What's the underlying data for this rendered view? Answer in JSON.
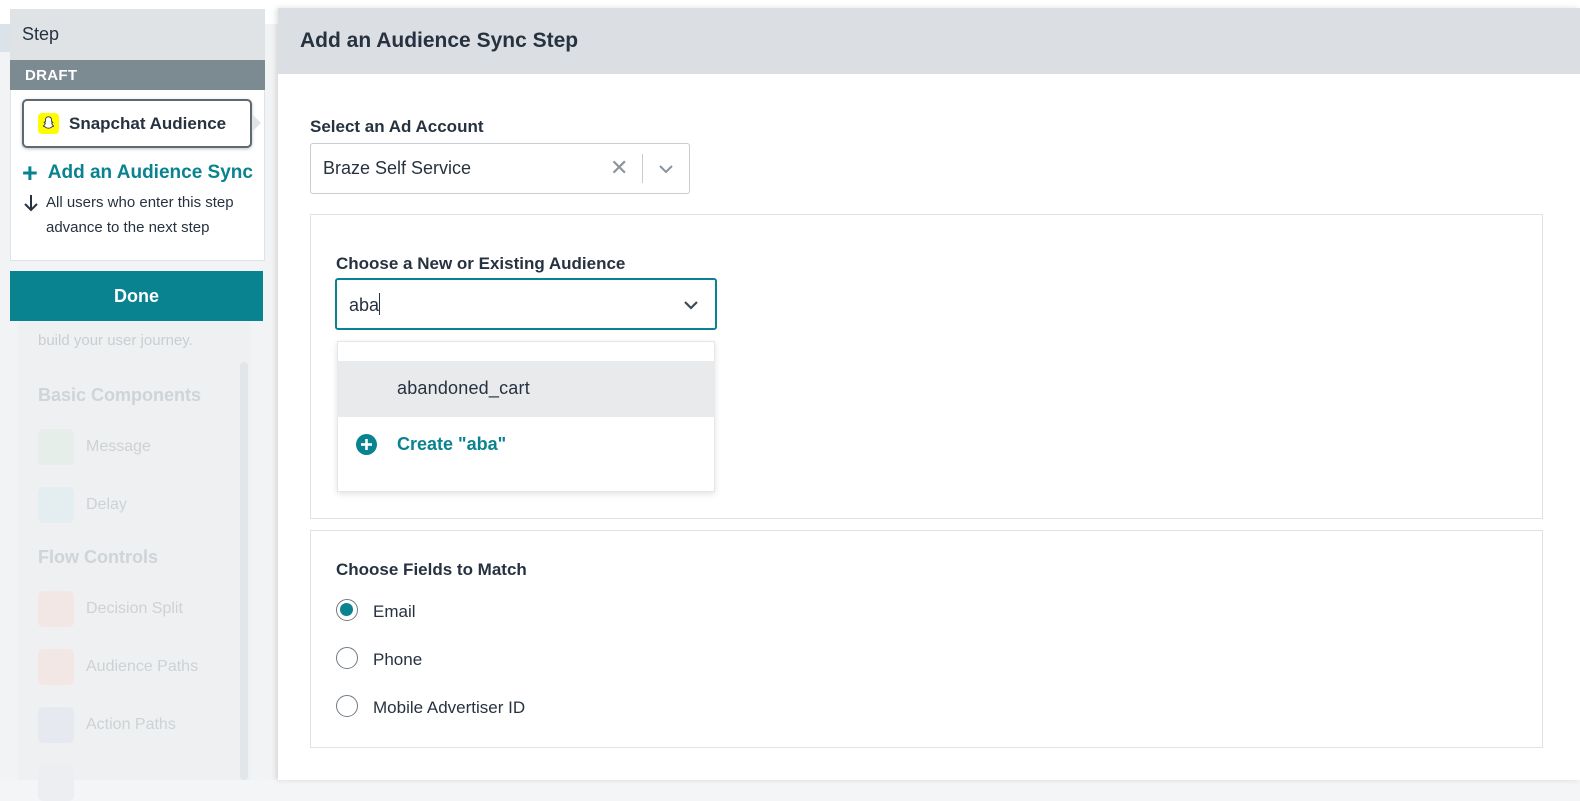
{
  "sidebar": {
    "step_title": "Step",
    "draft_label": "DRAFT",
    "step_card_label": "Snapchat Audience",
    "add_sync_label": "Add an Audience Sync",
    "advance_text": "All users who enter this step advance to the next step",
    "done_label": "Done"
  },
  "background_canvas": {
    "hint_text": "build your user journey.",
    "sections": [
      {
        "heading": "Basic Components",
        "items": [
          "Message",
          "Delay"
        ]
      },
      {
        "heading": "Flow Controls",
        "items": [
          "Decision Split",
          "Audience Paths",
          "Action Paths"
        ]
      }
    ]
  },
  "panel": {
    "title": "Add an Audience Sync Step",
    "ad_account": {
      "label": "Select an Ad Account",
      "value": "Braze Self Service"
    },
    "audience": {
      "label": "Choose a New or Existing Audience",
      "input_value": "aba",
      "options": [
        "abandoned_cart"
      ],
      "create_label": "Create \"aba\""
    },
    "fields": {
      "label": "Choose Fields to Match",
      "options": [
        {
          "label": "Email",
          "checked": true
        },
        {
          "label": "Phone",
          "checked": false
        },
        {
          "label": "Mobile Advertiser ID",
          "checked": false
        }
      ]
    }
  },
  "colors": {
    "accent": "#0a8390",
    "header_bg": "#dbdfe3",
    "draft_bar": "#7c8a92",
    "snapchat_yellow": "#fffc00"
  }
}
